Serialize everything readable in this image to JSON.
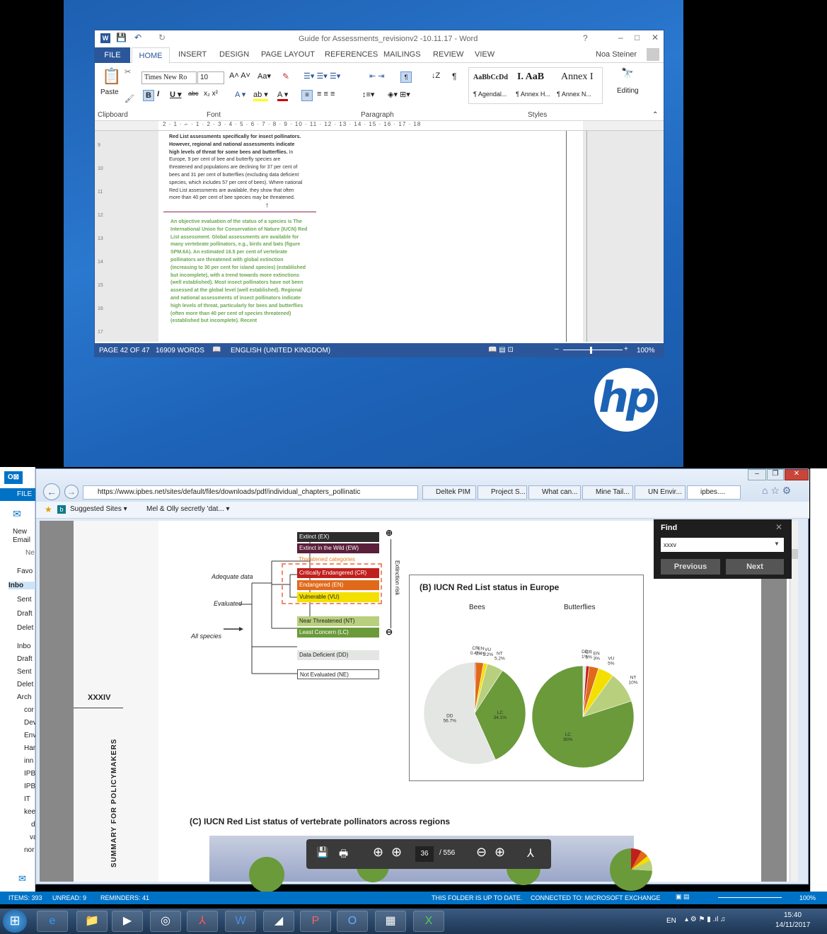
{
  "word": {
    "title": "Guide for Assessments_revisionv2 -10.11.17 - Word",
    "user": "Noa Steiner",
    "tabs": [
      "FILE",
      "HOME",
      "INSERT",
      "DESIGN",
      "PAGE LAYOUT",
      "REFERENCES",
      "MAILINGS",
      "REVIEW",
      "VIEW"
    ],
    "font_name": "Times New Ro",
    "font_size": "10",
    "paste_label": "Paste",
    "groups": [
      "Clipboard",
      "Font",
      "Paragraph",
      "Styles"
    ],
    "editing_label": "Editing",
    "styles": [
      {
        "sample": "AaBbCcDd",
        "name": "¶ Agendal..."
      },
      {
        "sample": "I. AaB",
        "name": "¶ Annex H..."
      },
      {
        "sample": "Annex I",
        "name": "¶ Annex N..."
      }
    ],
    "doc_text_1_bold": "Red List assessments specifically for insect pollinators. However, regional and national assessments indicate high levels of threat for some bees and butterflies.",
    "doc_text_1": "In Europe, 9 per cent of bee and butterfly species are threatened and populations are declining for 37 per cent of bees and 31 per cent of butterflies (excluding data deficient species, which includes 57 per cent of bees). Where national Red List assessments are available, they show that often more than 40 per cent of bee species may be threatened.",
    "doc_text_2": "An objective evaluation of the status of a species is The International Union for Conservation of Nature (IUCN) Red List assessment. Global assessments are available for many vertebrate pollinators, e.g., birds and bats (figure SPM.6A). An estimated 16.5 per cent of vertebrate pollinators are threatened with global extinction (increasing to 30 per cent for island species) (established but incomplete), with a trend towards more extinctions (well established). Most insect pollinators have not been assessed at the global level (well established). Regional and national assessments of insect pollinators indicate high levels of threat, particularly for bees and butterflies (often more than 40 per cent of species threatened) (established but incomplete). Recent",
    "ruler_numbers": [
      "1",
      "2",
      "3",
      "4",
      "5",
      "6",
      "7",
      "8",
      "9",
      "10",
      "11",
      "12",
      "13",
      "14",
      "15",
      "16",
      "17",
      "18"
    ],
    "status": {
      "page": "PAGE 42 OF 47",
      "words": "16909 WORDS",
      "lang": "ENGLISH (UNITED KINGDOM)",
      "zoom": "100%"
    }
  },
  "ie": {
    "url": "https://www.ipbes.net/sites/default/files/downloads/pdf/individual_chapters_pollinatic",
    "tabs": [
      "Deltek PIM",
      "Project S...",
      "What can...",
      "Mine Tail...",
      "UN Envir...",
      "ipbes...."
    ],
    "favorites": [
      "Suggested Sites ▾",
      "Mel & Olly secretly 'dat... ▾"
    ]
  },
  "pdf": {
    "side_label": "SUMMARY FOR POLICYMAKERS",
    "page_roman": "XXXIV",
    "tree": {
      "adequate": "Adequate data",
      "evaluated": "Evaluated",
      "all": "All species",
      "threatened": "Threatened categories",
      "extinction_risk": "Extinction risk",
      "categories": [
        {
          "label": "Extinct (EX)",
          "color": "#2d2d2d"
        },
        {
          "label": "Extinct in the Wild (EW)",
          "color": "#5a1f3a"
        },
        {
          "label": "Critically Endangered (CR)",
          "color": "#c0201d"
        },
        {
          "label": "Endangered (EN)",
          "color": "#e06a1a"
        },
        {
          "label": "Vulnerable (VU)",
          "color": "#f3e000"
        },
        {
          "label": "Near Threatened (NT)",
          "color": "#b8cf7e"
        },
        {
          "label": "Least Concern (LC)",
          "color": "#6a9a3a"
        },
        {
          "label": "Data Deficient (DD)",
          "color": "#e3e6e3"
        },
        {
          "label": "Not Evaluated (NE)",
          "color": "#ffffff"
        }
      ]
    },
    "panel_b_title": "(B) IUCN Red List status in Europe",
    "panel_c_title": "(C) IUCN Red List status of vertebrate pollinators across regions",
    "chart_data": [
      {
        "type": "pie",
        "title": "Bees",
        "categories": [
          "CR",
          "EN",
          "VU",
          "NT",
          "LC",
          "DD"
        ],
        "values": [
          0.4,
          2.4,
          1.2,
          5.2,
          34.1,
          56.7
        ],
        "labels": [
          "CR 0.4%",
          "EN 2.4%",
          "VU 1.2%",
          "NT 5.2%",
          "LC 34.1%",
          "DD 56.7%"
        ]
      },
      {
        "type": "pie",
        "title": "Butterflies",
        "categories": [
          "DD",
          "CR",
          "EN",
          "VU",
          "NT",
          "LC"
        ],
        "values": [
          1,
          1,
          3,
          5,
          10,
          80
        ],
        "labels": [
          "DD 1%",
          "CR 1%",
          "EN 3%",
          "VU 5%",
          "NT 10%",
          "LC 80%"
        ]
      }
    ],
    "pie_colors": {
      "CR": "#c0201d",
      "EN": "#e06a1a",
      "VU": "#f3e000",
      "NT": "#b8cf7e",
      "LC": "#6a9a3a",
      "DD": "#e3e6e3"
    },
    "find": {
      "label": "Find",
      "value": "xxxv",
      "prev": "Previous",
      "next": "Next"
    },
    "toolbar": {
      "page": "36",
      "total": "/ 556"
    }
  },
  "outlook": {
    "file": "FILE",
    "new_email": "New Email",
    "new_label": "Ne",
    "folders": [
      "Favo",
      "Inbo",
      "Sent",
      "Draft",
      "Delet",
      "Inbo",
      "Draft",
      "Sent",
      "Delet",
      "Arch",
      "cor",
      "Dev",
      "Env",
      "Har",
      "inn",
      "IPB",
      "IPB",
      "IT",
      "kee",
      "d",
      "va",
      "nor",
      "nar"
    ],
    "status": {
      "items": "ITEMS: 393",
      "unread": "UNREAD: 9",
      "reminders": "REMINDERS: 41",
      "uptodate": "THIS FOLDER IS UP TO DATE.",
      "connected": "CONNECTED TO: MICROSOFT EXCHANGE",
      "zoom": "100%"
    }
  },
  "taskbar": {
    "lang": "EN",
    "time": "15:40",
    "date": "14/11/2017"
  }
}
